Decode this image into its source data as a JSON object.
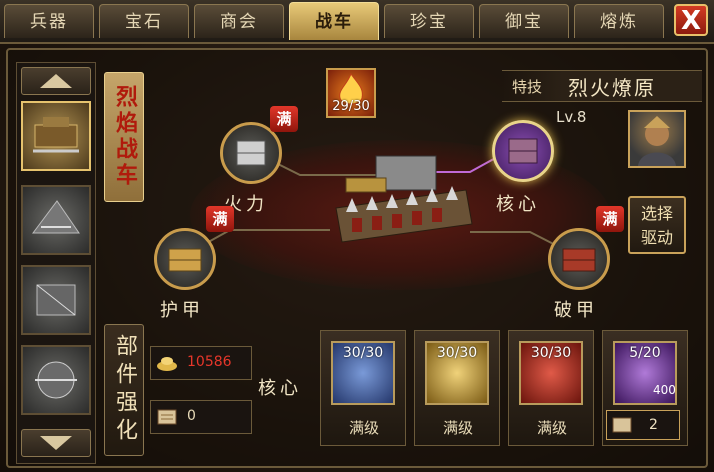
{
  "tabs": [
    "兵器",
    "宝石",
    "商会",
    "战车",
    "珍宝",
    "御宝",
    "熔炼"
  ],
  "active_tab": "战车",
  "close_label": "X",
  "title_vertical": "烈焰战车",
  "skill": {
    "count": "29/30",
    "label": "特技",
    "name": "烈火燎原"
  },
  "level": "Lv.8",
  "select_button": [
    "选择",
    "驱动"
  ],
  "nodes": {
    "fire": "火力",
    "core": "核心",
    "armor": "护甲",
    "pierce": "破甲"
  },
  "max_badge": "满",
  "section_title": "部件强化",
  "core_label": "核心",
  "resources": {
    "gold": "10586",
    "scroll": "0"
  },
  "materials": [
    {
      "count": "30/30",
      "status": "满级",
      "color": "#3a5a9a"
    },
    {
      "count": "30/30",
      "status": "满级",
      "color": "#c9a12e"
    },
    {
      "count": "30/30",
      "status": "满级",
      "color": "#b8261c"
    },
    {
      "count": "5/20",
      "status": "",
      "color": "#7a3aa8",
      "extra": "400"
    }
  ],
  "stepper_value": "2",
  "colors": {
    "accent": "#e8c978",
    "badge": "#d82a1e",
    "text": "#f0e4c4"
  }
}
